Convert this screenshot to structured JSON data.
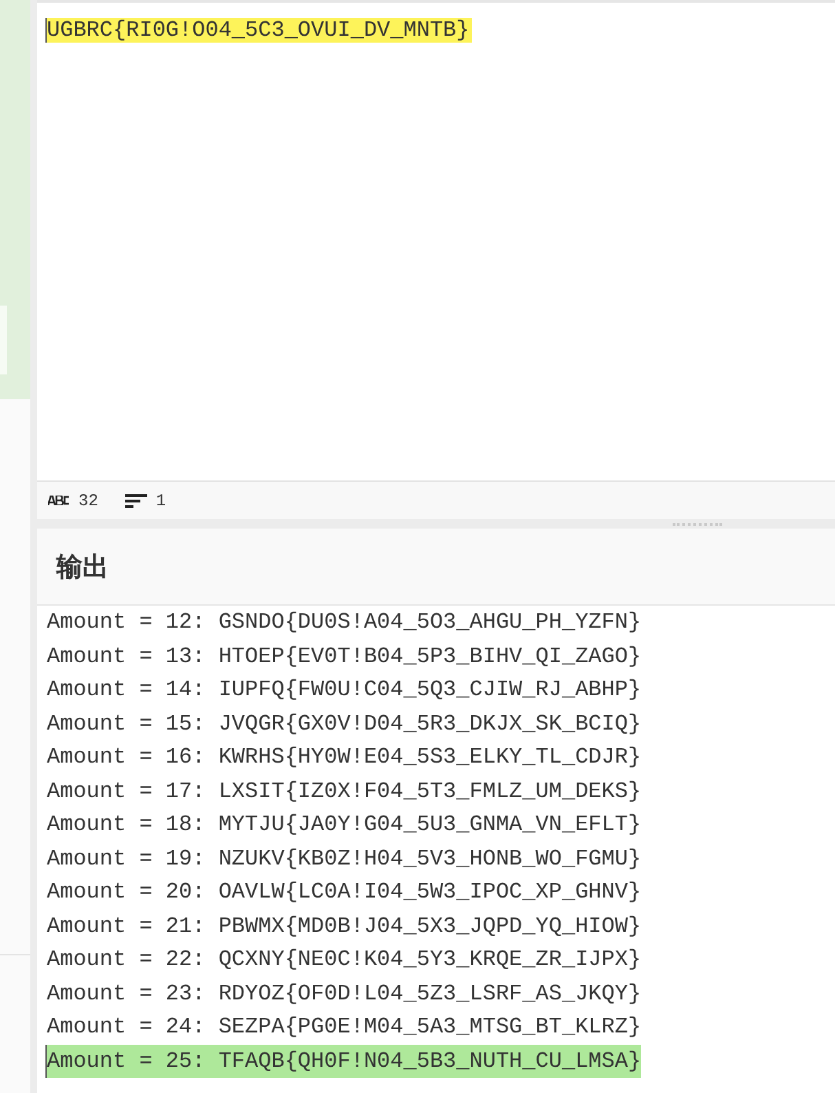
{
  "editor": {
    "text": "UGBRC{RI0G!O04_5C3_OVUI_DV_MNTB}",
    "highlighted": true
  },
  "status_bar": {
    "char_count": "32",
    "line_count": "1"
  },
  "output": {
    "title": "输出",
    "lines": [
      {
        "text": "Amount = 12: GSNDO{DU0S!A04_5O3_AHGU_PH_YZFN}",
        "selected": false
      },
      {
        "text": "Amount = 13: HTOEP{EV0T!B04_5P3_BIHV_QI_ZAGO}",
        "selected": false
      },
      {
        "text": "Amount = 14: IUPFQ{FW0U!C04_5Q3_CJIW_RJ_ABHP}",
        "selected": false
      },
      {
        "text": "Amount = 15: JVQGR{GX0V!D04_5R3_DKJX_SK_BCIQ}",
        "selected": false
      },
      {
        "text": "Amount = 16: KWRHS{HY0W!E04_5S3_ELKY_TL_CDJR}",
        "selected": false
      },
      {
        "text": "Amount = 17: LXSIT{IZ0X!F04_5T3_FMLZ_UM_DEKS}",
        "selected": false
      },
      {
        "text": "Amount = 18: MYTJU{JA0Y!G04_5U3_GNMA_VN_EFLT}",
        "selected": false
      },
      {
        "text": "Amount = 19: NZUKV{KB0Z!H04_5V3_HONB_WO_FGMU}",
        "selected": false
      },
      {
        "text": "Amount = 20: OAVLW{LC0A!I04_5W3_IPOC_XP_GHNV}",
        "selected": false
      },
      {
        "text": "Amount = 21: PBWMX{MD0B!J04_5X3_JQPD_YQ_HIOW}",
        "selected": false
      },
      {
        "text": "Amount = 22: QCXNY{NE0C!K04_5Y3_KRQE_ZR_IJPX}",
        "selected": false
      },
      {
        "text": "Amount = 23: RDYOZ{OF0D!L04_5Z3_LSRF_AS_JKQY}",
        "selected": false
      },
      {
        "text": "Amount = 24: SEZPA{PG0E!M04_5A3_MTSG_BT_KLRZ}",
        "selected": false
      },
      {
        "text": "Amount = 25: TFAQB{QH0F!N04_5B3_NUTH_CU_LMSA}",
        "selected": true
      }
    ]
  }
}
